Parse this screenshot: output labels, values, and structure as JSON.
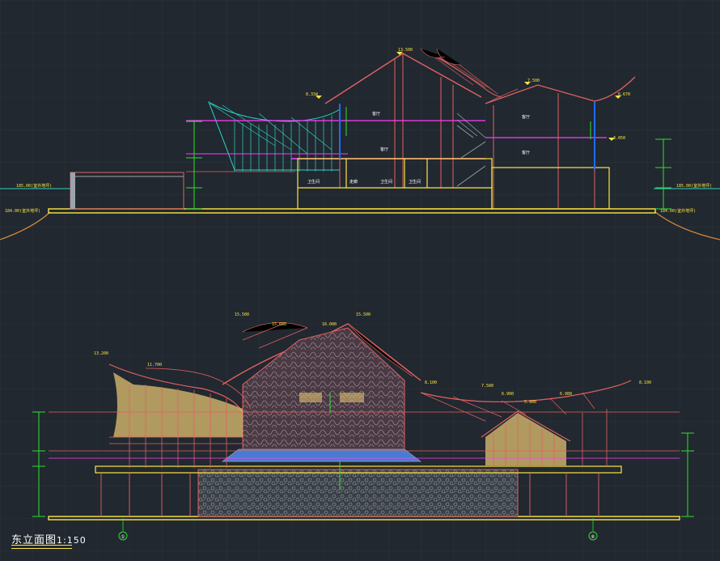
{
  "colors": {
    "bg": "#212830",
    "grid": "#2a323c",
    "roof": "#ff5a5a",
    "struct": "#e36161",
    "cyan": "#2ed3c5",
    "yellow": "#ffe640",
    "magenta": "#ff3cff",
    "green": "#2ee02e",
    "orange": "#d98a3a",
    "white": "#ffffff",
    "grey": "#9aa4ad",
    "blue": "#1f6bff"
  },
  "section": {
    "elevations": [
      {
        "id": "ridge",
        "text": "13.500"
      },
      {
        "id": "left-eave",
        "text": "8.334"
      },
      {
        "id": "right-ridge",
        "text": "7.500"
      },
      {
        "id": "right-eave",
        "text": "6.670"
      },
      {
        "id": "right-floor",
        "text": "3.050"
      },
      {
        "id": "ground-left",
        "text": "185.00(室外地坪)"
      },
      {
        "id": "ground-right",
        "text": "185.00(室外地坪)"
      },
      {
        "id": "base-left",
        "text": "184.00(室外地坪)"
      },
      {
        "id": "base-right",
        "text": "184.00(室外地坪)"
      }
    ],
    "rooms": [
      "客厅",
      "客厅",
      "客厅",
      "客厅",
      "卫生间",
      "走廊",
      "卫生间",
      "卫生间"
    ]
  },
  "elevation": {
    "title": "东立面图",
    "scale": "1:150",
    "levels": [
      {
        "id": "top-left-1",
        "text": "15.500"
      },
      {
        "id": "top-mid-1",
        "text": "15.600"
      },
      {
        "id": "top-center",
        "text": "16.000"
      },
      {
        "id": "top-right-1",
        "text": "15.500"
      },
      {
        "id": "left-eave",
        "text": "13.200"
      },
      {
        "id": "left-roof",
        "text": "11.700"
      },
      {
        "id": "right-1",
        "text": "8.100"
      },
      {
        "id": "right-2",
        "text": "7.500"
      },
      {
        "id": "right-3",
        "text": "6.900"
      },
      {
        "id": "right-4",
        "text": "5.900"
      },
      {
        "id": "right-5",
        "text": "6.900"
      },
      {
        "id": "right-6",
        "text": "8.100"
      }
    ],
    "axes": [
      {
        "id": "axis-left",
        "text": "①"
      },
      {
        "id": "axis-right",
        "text": "⑥"
      }
    ]
  }
}
